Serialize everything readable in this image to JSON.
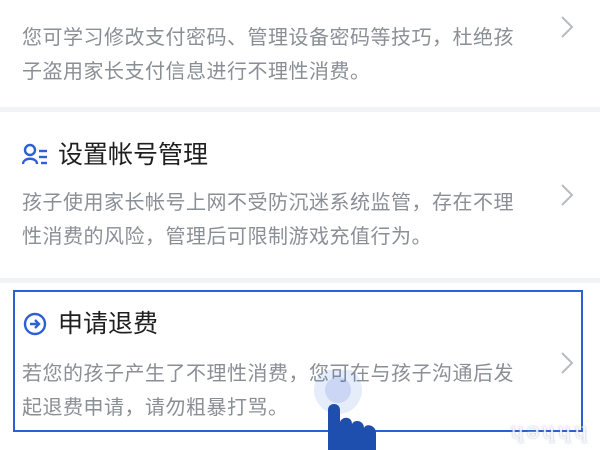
{
  "items": [
    {
      "title": "",
      "description": "您可学习修改支付密码、管理设备密码等技巧，杜绝孩子盗用家长支付信息进行不理性消费。",
      "icon": "chevron-right-icon"
    },
    {
      "title": "设置帐号管理",
      "description": "孩子使用家长帐号上网不受防沉迷系统监管，存在不理性消费的风险，管理后可限制游戏充值行为。",
      "icon": "user-manage-icon"
    },
    {
      "title": "申请退费",
      "description": "若您的孩子产生了不理性消费，您可在与孩子沟通后发起退费申请，请勿粗暴打骂。",
      "icon": "arrow-circle-icon"
    }
  ],
  "colors": {
    "accent": "#2d5fd8",
    "title_text": "#1f1f1f",
    "desc_text": "#8a8f96",
    "background": "#f2f3f5"
  },
  "watermark": "ɥǝɥɥɥ"
}
